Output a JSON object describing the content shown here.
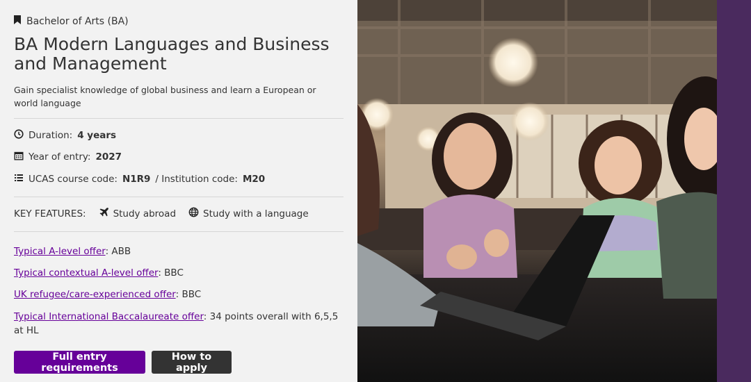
{
  "course": {
    "degree_type": "Bachelor of Arts (BA)",
    "title": "BA Modern Languages and Business and Management",
    "subtitle": "Gain specialist knowledge of global business and learn a European or world language"
  },
  "details": {
    "duration_label": "Duration:",
    "duration_value": "4 years",
    "entry_label": "Year of entry:",
    "entry_value": "2027",
    "ucas_label": "UCAS course code:",
    "ucas_value": "N1R9",
    "institution_label": "/ Institution code:",
    "institution_value": "M20"
  },
  "key_features": {
    "label": "KEY FEATURES:",
    "items": [
      "Study abroad",
      "Study with a language"
    ]
  },
  "offers": [
    {
      "link": "Typical A-level offer",
      "value": ": ABB"
    },
    {
      "link": "Typical contextual A-level offer",
      "value": ": BBC"
    },
    {
      "link": "UK refugee/care-experienced offer",
      "value": ": BBC"
    },
    {
      "link": "Typical International Baccalaureate offer",
      "value": ": 34 points overall with 6,5,5 at HL"
    }
  ],
  "buttons": {
    "entry_requirements": "Full entry requirements",
    "how_to_apply": "How to apply"
  },
  "colors": {
    "accent_purple": "#660099",
    "dark_button": "#333333",
    "panel_background": "#f2f2f2",
    "side_strip": "#4a2a5e"
  },
  "icons": {
    "degree": "bookmark-icon",
    "duration": "clock-icon",
    "entry": "calendar-icon",
    "ucas": "list-icon",
    "study_abroad": "airplane-icon",
    "language": "globe-icon"
  }
}
